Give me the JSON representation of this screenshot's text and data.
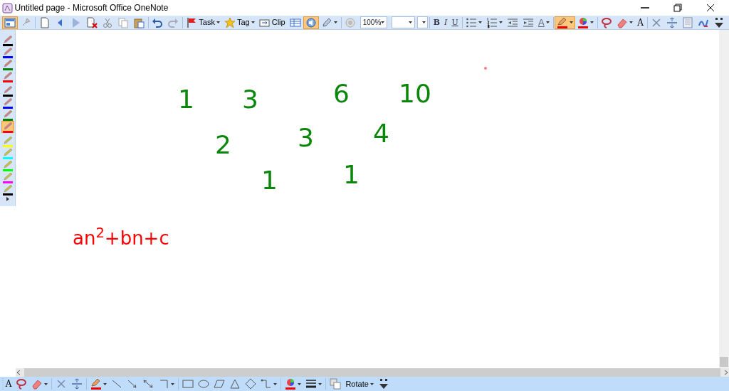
{
  "window": {
    "title": "Untitled page - Microsoft Office OneNote"
  },
  "toolbar": {
    "view_button": {
      "on": true
    },
    "task_label": "Task",
    "tag_label": "Tag",
    "clip_label": "Clip",
    "audio_button": {
      "on": true
    },
    "zoom": "100%",
    "format_letters": [
      "B",
      "I",
      "U"
    ],
    "font_color_letter": "A",
    "pen_color_button": {
      "on": true
    },
    "text_mode_letter": "A"
  },
  "pens": [
    {
      "color": "#000000",
      "selected": false
    },
    {
      "color": "#0000ff",
      "selected": false
    },
    {
      "color": "#008000",
      "selected": false
    },
    {
      "color": "#ff0000",
      "selected": false
    },
    {
      "color": "#000000",
      "selected": false
    },
    {
      "color": "#0000ff",
      "selected": false
    },
    {
      "color": "#008000",
      "selected": false
    },
    {
      "color": "#ff0000",
      "selected": true
    },
    {
      "color": "#ffff00",
      "selected": false
    },
    {
      "color": "#00ffff",
      "selected": false
    },
    {
      "color": "#00ff00",
      "selected": false
    },
    {
      "color": "#ff00ff",
      "selected": false
    },
    {
      "color": "#000000",
      "selected": false
    }
  ],
  "ink": {
    "number_rows": [
      [
        "1",
        "3",
        "6",
        "10"
      ],
      [
        "2",
        "3",
        "4"
      ],
      [
        "1",
        "1"
      ]
    ],
    "formula": "an$^{2}$+bn+c"
  },
  "drawing_toolbar": {
    "text_mode_letter": "A",
    "rotate_label": "Rotate"
  }
}
